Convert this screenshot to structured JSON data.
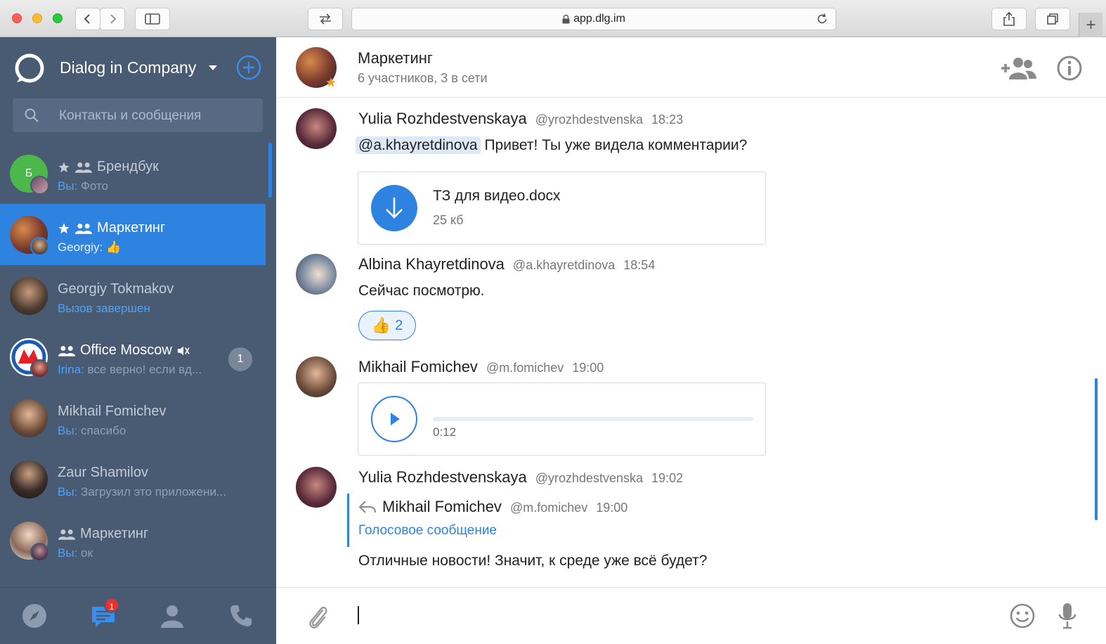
{
  "browser": {
    "url": "app.dlg.im"
  },
  "sidebar": {
    "company": "Dialog in Company",
    "search_placeholder": "Контакты и сообщения",
    "chats": [
      {
        "name": "Брендбук",
        "who": "Вы:",
        "preview": "Фото",
        "starred": true,
        "group": true,
        "avatar_letter": "Б",
        "avatar_color": "#4cb84c"
      },
      {
        "name": "Маркетинг",
        "who": "Georgiy:",
        "preview": "👍",
        "starred": true,
        "group": true,
        "active": true
      },
      {
        "name": "Georgiy Tokmakov",
        "who": "",
        "preview": "Вызов завершен"
      },
      {
        "name": "Office Moscow",
        "who": "Irina:",
        "preview": "все верно! если вд...",
        "group": true,
        "muted": true,
        "unread": "1"
      },
      {
        "name": "Mikhail Fomichev",
        "who": "Вы:",
        "preview": "спасибо"
      },
      {
        "name": "Zaur Shamilov",
        "who": "Вы:",
        "preview": "Загрузил это приложени..."
      },
      {
        "name": "Маркетинг",
        "who": "Вы:",
        "preview": "ок",
        "group": true
      }
    ],
    "nav_badge": "1"
  },
  "header": {
    "title": "Маркетинг",
    "subtitle": "6 участников, 3 в сети"
  },
  "messages": [
    {
      "author": "Yulia Rozhdestvenskaya",
      "handle": "@yrozhdestvenska",
      "time": "18:23",
      "mention": "@a.khayretdinova",
      "text": "Привет! Ты уже видела комментарии?",
      "file": {
        "name": "ТЗ для видео.docx",
        "size": "25 кб"
      }
    },
    {
      "author": "Albina Khayretdinova",
      "handle": "@a.khayretdinova",
      "time": "18:54",
      "text": "Сейчас посмотрю.",
      "reaction": {
        "emoji": "👍",
        "count": "2"
      }
    },
    {
      "author": "Mikhail Fomichev",
      "handle": "@m.fomichev",
      "time": "19:00",
      "audio": {
        "duration": "0:12"
      }
    },
    {
      "author": "Yulia Rozhdestvenskaya",
      "handle": "@yrozhdestvenska",
      "time": "19:02",
      "reply": {
        "author": "Mikhail Fomichev",
        "handle": "@m.fomichev",
        "time": "19:00",
        "text": "Голосовое сообщение"
      },
      "text": "Отличные новости! Значит, к среде уже всё будет?"
    }
  ],
  "composer": {
    "value": ""
  },
  "colors": {
    "accent": "#2f83e0",
    "sidebar": "#495a73"
  }
}
